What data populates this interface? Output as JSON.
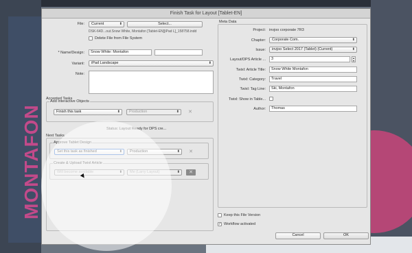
{
  "window_title": "Finish Task for Layout [Tablet-EN]",
  "file": {
    "label": "File:",
    "value": "Current",
    "select_button": "Select...",
    "path": "DSK-64D...out.Snow White, Montafon [Tablet-EN][iPad L]_158758.indd",
    "delete_label": "Delete File from File System"
  },
  "name_design": {
    "label": "* Name/Design:",
    "value": "Snow White: Montafon",
    "value2": ""
  },
  "variant": {
    "label": "Variant:",
    "value": "iPad Landscape"
  },
  "note": {
    "label": "Note:",
    "value": ""
  },
  "accepted_tasks": {
    "title": "Accepted Tasks",
    "subgroup": "Add Interactive Objects",
    "action": "Finish this task",
    "role": "Production",
    "status": "Status: Layout Ready for DPS cre..."
  },
  "next_tasks": {
    "title": "Next Tasks",
    "approve": {
      "title": "Approve Tablet Design",
      "action": "Set this task as finished",
      "role": "Production"
    },
    "create": {
      "title": "Create & Upload Twixl Article",
      "action": "Will become available",
      "role": "Me (Larry Layout)"
    }
  },
  "meta": {
    "title": "Meta Data",
    "project_label": "Project:",
    "project_value": "invjoo corporate 7R3",
    "chapter_label": "Chapter:",
    "chapter_value": "Corporate Com.",
    "issue_label": "Issue:",
    "issue_value": "invjoo Select 2017 (Tablet) (Current)",
    "layout_label": "Layout/DPS Article ...",
    "layout_value": "3",
    "article_title_label": "Twixl: Article Title:",
    "article_title_value": "Snow White Montafon",
    "category_label": "Twixl: Category:",
    "category_value": "Travel",
    "tagline_label": "Twixl: Tag Line:",
    "tagline_value": "Ski, Montafon",
    "show_table_label": "Twixl: Show in Table...",
    "author_label": "Author:",
    "author_value": "Thomas"
  },
  "options": {
    "keep_version": "Keep this File Version",
    "workflow": "Workflow activated"
  },
  "buttons": {
    "cancel": "Cancel",
    "ok": "OK"
  },
  "background": {
    "word": "MONTAFON"
  }
}
